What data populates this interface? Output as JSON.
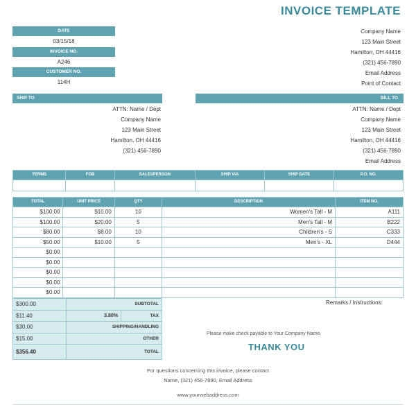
{
  "title": "INVOICE TEMPLATE",
  "meta": {
    "date_label": "DATE",
    "date_value": "03/15/18",
    "invoice_no_label": "INVOICE NO.",
    "invoice_no_value": "A246",
    "customer_no_label": "CUSTOMER NO.",
    "customer_no_value": "114H"
  },
  "company": {
    "name": "Company Name",
    "street": "123 Main Street",
    "city": "Hamilton, OH 44416",
    "phone": "(321) 456-7890",
    "email": "Email Address",
    "contact": "Point of Contact"
  },
  "ship_to": {
    "label": "SHIP TO",
    "lines": [
      "ATTN: Name / Dept",
      "Company Name",
      "123 Main Street",
      "Hamilton, OH 44416",
      "(321) 456-7890"
    ]
  },
  "bill_to": {
    "label": "BILL TO",
    "lines": [
      "ATTN: Name / Dept",
      "Company Name",
      "123 Main Street",
      "Hamilton, OH 44416",
      "(321) 456-7890",
      "Email Address"
    ]
  },
  "terms_table": {
    "headers": [
      "P.O. NO.",
      "SHIP DATE",
      "SHIP VIA",
      "SALESPERSON",
      "FOB",
      "TERMS"
    ]
  },
  "items_table": {
    "headers": [
      "ITEM NO.",
      "DESCRIPTION",
      "QTY",
      "UNIT PRICE",
      "TOTAL"
    ],
    "rows": [
      {
        "item": "A111",
        "desc": "Women's Tall - M",
        "qty": "10",
        "unit": "$10.00",
        "total": "$100.00"
      },
      {
        "item": "B222",
        "desc": "Men's Tall - M",
        "qty": "5",
        "unit": "$20.00",
        "total": "$100.00"
      },
      {
        "item": "C333",
        "desc": "Children's - S",
        "qty": "10",
        "unit": "$8.00",
        "total": "$80.00"
      },
      {
        "item": "D444",
        "desc": "Men's - XL",
        "qty": "5",
        "unit": "$10.00",
        "total": "$50.00"
      },
      {
        "item": "",
        "desc": "",
        "qty": "",
        "unit": "",
        "total": "$0.00"
      },
      {
        "item": "",
        "desc": "",
        "qty": "",
        "unit": "",
        "total": "$0.00"
      },
      {
        "item": "",
        "desc": "",
        "qty": "",
        "unit": "",
        "total": "$0.00"
      },
      {
        "item": "",
        "desc": "",
        "qty": "",
        "unit": "",
        "total": "$0.00"
      },
      {
        "item": "",
        "desc": "",
        "qty": "",
        "unit": "",
        "total": "$0.00"
      }
    ]
  },
  "remarks_label": "Remarks / Instructions:",
  "totals": {
    "subtotal_label": "SUBTOTAL",
    "subtotal_value": "$300.00",
    "tax_label": "TAX",
    "tax_rate": "3.80%",
    "tax_value": "$11.40",
    "shipping_label": "SHIPPING/HANDLING",
    "shipping_value": "$30.00",
    "other_label": "OTHER",
    "other_value": "$15.00",
    "total_label": "TOTAL",
    "total_value": "$356.40"
  },
  "payable_note": "Please make check payable to Your Company Name.",
  "thank_you": "THANK YOU",
  "contact_note_1": "For questions concerning this invoice, please contact",
  "contact_note_2": "Name, (321) 456-7890, Email Address",
  "website": "www.yourwebaddress.com"
}
